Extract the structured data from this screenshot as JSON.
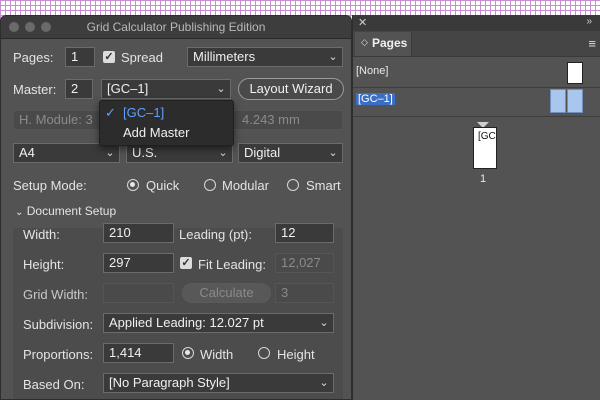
{
  "dialog": {
    "title": "Grid Calculator Publishing Edition",
    "pages_label": "Pages:",
    "pages_value": "1",
    "spread_label": "Spread",
    "spread_checked": true,
    "units_value": "Millimeters",
    "master_label": "Master:",
    "master_count": "2",
    "master_value": "[GC–1]",
    "layout_wizard_label": "Layout Wizard",
    "hmodule_text_left": "H. Module: 3",
    "hmodule_text_right": "4.243 mm",
    "size_value": "A4",
    "region_value": "U.S.",
    "output_value": "Digital",
    "setup_mode_label": "Setup Mode:",
    "modes": [
      "Quick",
      "Modular",
      "Smart"
    ],
    "selected_mode": "Quick",
    "master_menu": {
      "items": [
        {
          "label": "[GC–1]",
          "checked": true
        },
        {
          "label": "Add Master",
          "checked": false
        }
      ]
    },
    "document_setup": {
      "section_label": "Document Setup",
      "width_label": "Width:",
      "width_value": "210",
      "leading_label": "Leading (pt):",
      "leading_value": "12",
      "height_label": "Height:",
      "height_value": "297",
      "fit_leading_label": "Fit Leading:",
      "fit_leading_checked": true,
      "fit_leading_value": "12,027",
      "grid_width_label": "Grid Width:",
      "grid_width_value": "",
      "calculate_label": "Calculate",
      "calculate_value": "3",
      "subdivision_label": "Subdivision:",
      "subdivision_value": "Applied Leading: 12.027 pt",
      "proportions_label": "Proportions:",
      "proportions_value": "1,414",
      "orientation_options": [
        "Width",
        "Height"
      ],
      "orientation_selected": "Width",
      "based_on_label": "Based On:",
      "based_on_value": "[No Paragraph Style]"
    }
  },
  "pages_panel": {
    "tab_label": "Pages",
    "masters": [
      {
        "label": "[None]",
        "selected": false
      },
      {
        "label": "[GC–1]",
        "selected": true
      }
    ],
    "page_thumb_label": "[GC",
    "page_number": "1"
  },
  "colors": {
    "panel_bg": "#535353",
    "field_bg": "#3a3a3a",
    "accent_selection": "#a9c6ef",
    "menu_highlight_text": "#5ea0ff"
  }
}
